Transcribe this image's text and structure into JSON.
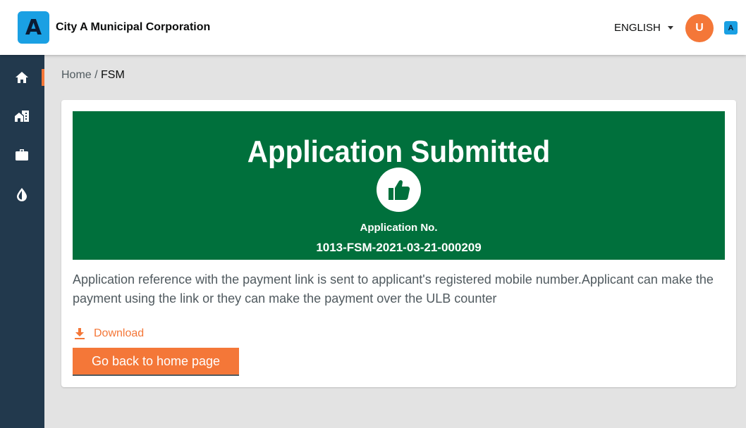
{
  "header": {
    "logo_letter": "A",
    "corporation_name": "City A Municipal Corporation",
    "language": "ENGLISH",
    "avatar_initial": "U",
    "mini_logo_letter": "A"
  },
  "sidebar": {
    "items": [
      {
        "icon": "home-icon",
        "active": true
      },
      {
        "icon": "city-buildings-icon",
        "active": false
      },
      {
        "icon": "briefcase-icon",
        "active": false
      },
      {
        "icon": "water-drop-icon",
        "active": false
      }
    ]
  },
  "breadcrumb": {
    "home": "Home",
    "separator": " / ",
    "current": "FSM"
  },
  "banner": {
    "title": "Application Submitted",
    "icon": "thumbs-up-icon",
    "application_label": "Application No.",
    "application_number": "1013-FSM-2021-03-21-000209"
  },
  "message": "Application reference with the payment link is sent to applicant's registered mobile number.Applicant can make the payment using the link or they can make the payment over the ULB counter",
  "actions": {
    "download_label": "Download",
    "home_button_label": "Go back to home page"
  },
  "colors": {
    "success_green": "#00703c",
    "accent_orange": "#f47738",
    "sidebar_navy": "#22394d",
    "logo_blue": "#1aa0e3"
  }
}
